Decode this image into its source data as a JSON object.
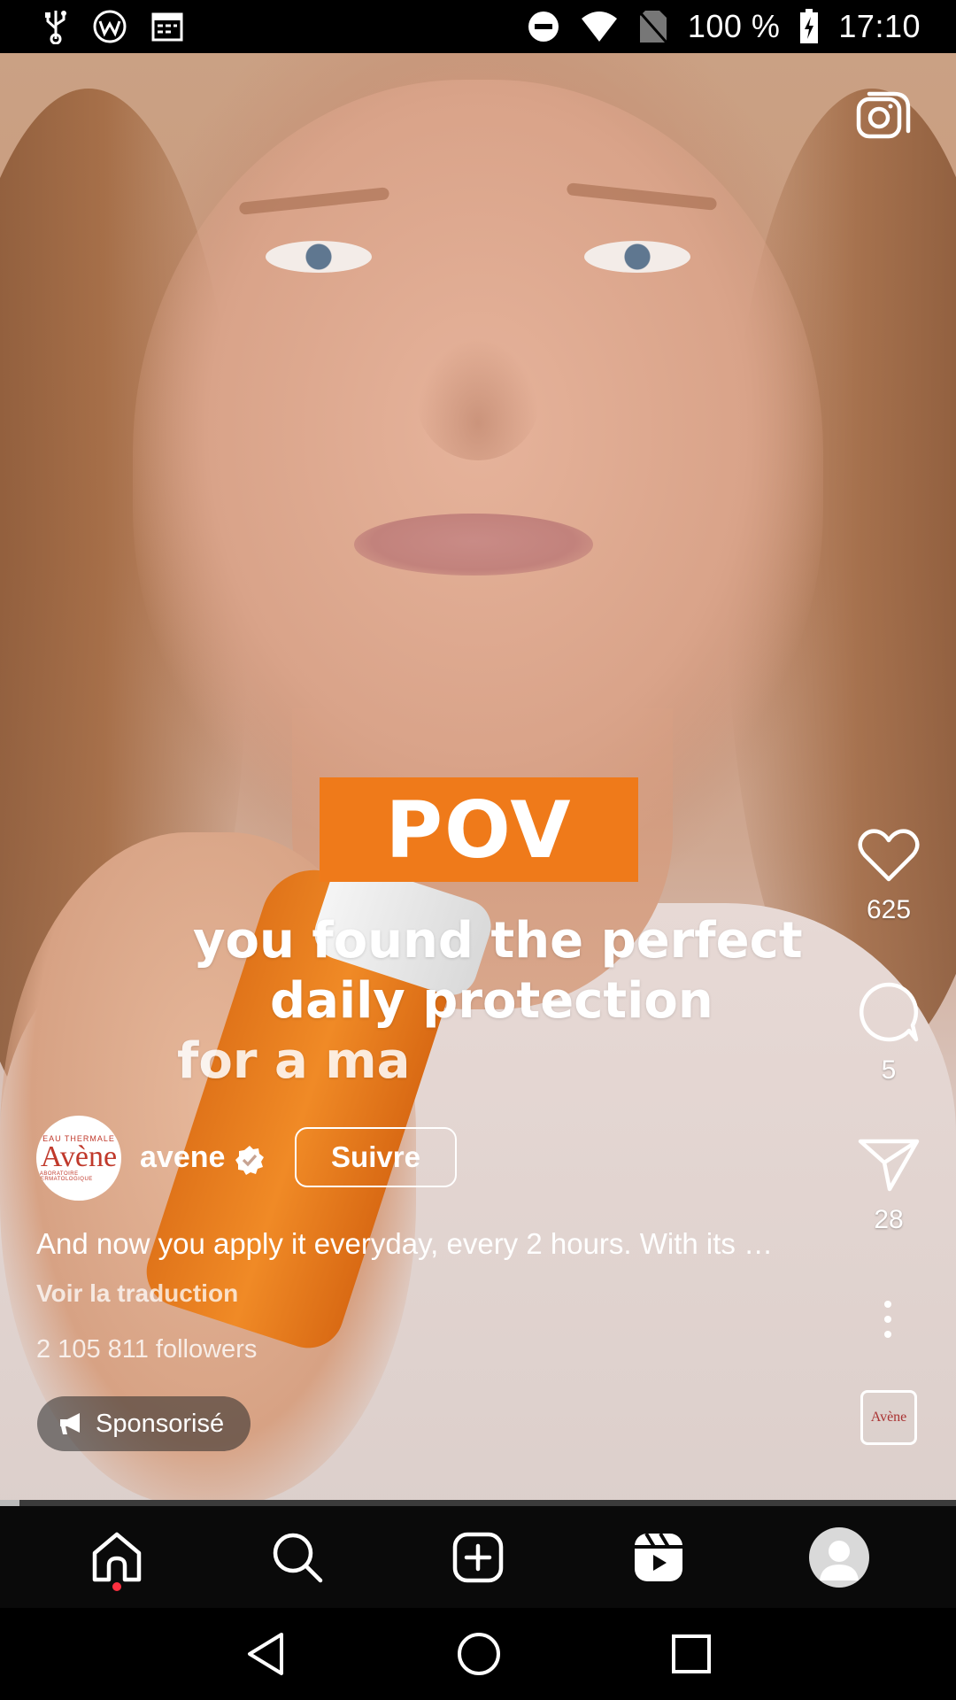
{
  "status_bar": {
    "battery_percent": "100 %",
    "time": "17:10",
    "icons": [
      "usb-icon",
      "vpn-icon",
      "calendar-icon",
      "do-not-disturb-icon",
      "wifi-icon",
      "no-sim-icon",
      "battery-charging-icon"
    ]
  },
  "video": {
    "overlay_title": "POV",
    "overlay_line1": "you found the perfect",
    "overlay_line2": "daily protection",
    "overlay_line3": "for a ma",
    "accent_color": "#ef7a1a",
    "playback_progress": 0.02
  },
  "actions": {
    "like_count": "625",
    "comment_count": "5",
    "share_count": "28"
  },
  "post": {
    "avatar_small_text": "EAU THERMALE",
    "avatar_brand": "Avène",
    "avatar_subtext": "LABORATOIRE DERMATOLOGIQUE",
    "username": "avene",
    "follow_label": "Suivre",
    "caption": "And now you apply it everyday, every 2 hours. With its …",
    "translate_label": "Voir la traduction",
    "followers": "2 105 811 followers",
    "sponsored_label": "Sponsorisé",
    "music_thumb_text": "Avène"
  },
  "nav": {
    "items": [
      "home-icon",
      "search-icon",
      "create-icon",
      "reels-icon",
      "profile-avatar"
    ]
  }
}
